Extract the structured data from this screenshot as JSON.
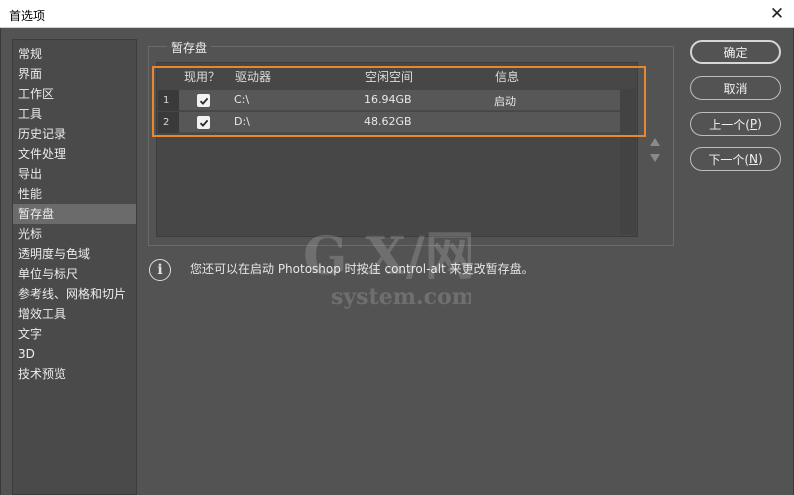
{
  "window": {
    "title": "首选项",
    "close_symbol": "✕"
  },
  "sidebar": {
    "items": [
      {
        "label": "常规"
      },
      {
        "label": "界面"
      },
      {
        "label": "工作区"
      },
      {
        "label": "工具"
      },
      {
        "label": "历史记录"
      },
      {
        "label": "文件处理"
      },
      {
        "label": "导出"
      },
      {
        "label": "性能"
      },
      {
        "label": "暂存盘",
        "active": true
      },
      {
        "label": "光标"
      },
      {
        "label": "透明度与色域"
      },
      {
        "label": "单位与标尺"
      },
      {
        "label": "参考线、网格和切片"
      },
      {
        "label": "增效工具"
      },
      {
        "label": "文字"
      },
      {
        "label": "3D"
      },
      {
        "label": "技术预览"
      }
    ]
  },
  "scratch": {
    "legend": "暂存盘",
    "columns": {
      "active": "现用？",
      "drive": "驱动器",
      "free": "空闲空间",
      "info": "信息"
    },
    "rows": [
      {
        "num": "1",
        "checked": true,
        "drive": "C:\\",
        "free": "16.94GB",
        "info": "启动"
      },
      {
        "num": "2",
        "checked": true,
        "drive": "D:\\",
        "free": "48.62GB",
        "info": ""
      }
    ],
    "highlight_color": "#e8872f"
  },
  "info_text": "您还可以在启动 Photoshop 时按住 control-alt 来更改暂存盘。",
  "buttons": {
    "ok": "确定",
    "cancel": "取消",
    "prev": "上一个(",
    "prev_key": "P",
    "prev_end": ")",
    "next": "下一个(",
    "next_key": "N",
    "next_end": ")"
  },
  "watermark": {
    "logo": "G X/网",
    "domain": "system.com"
  }
}
